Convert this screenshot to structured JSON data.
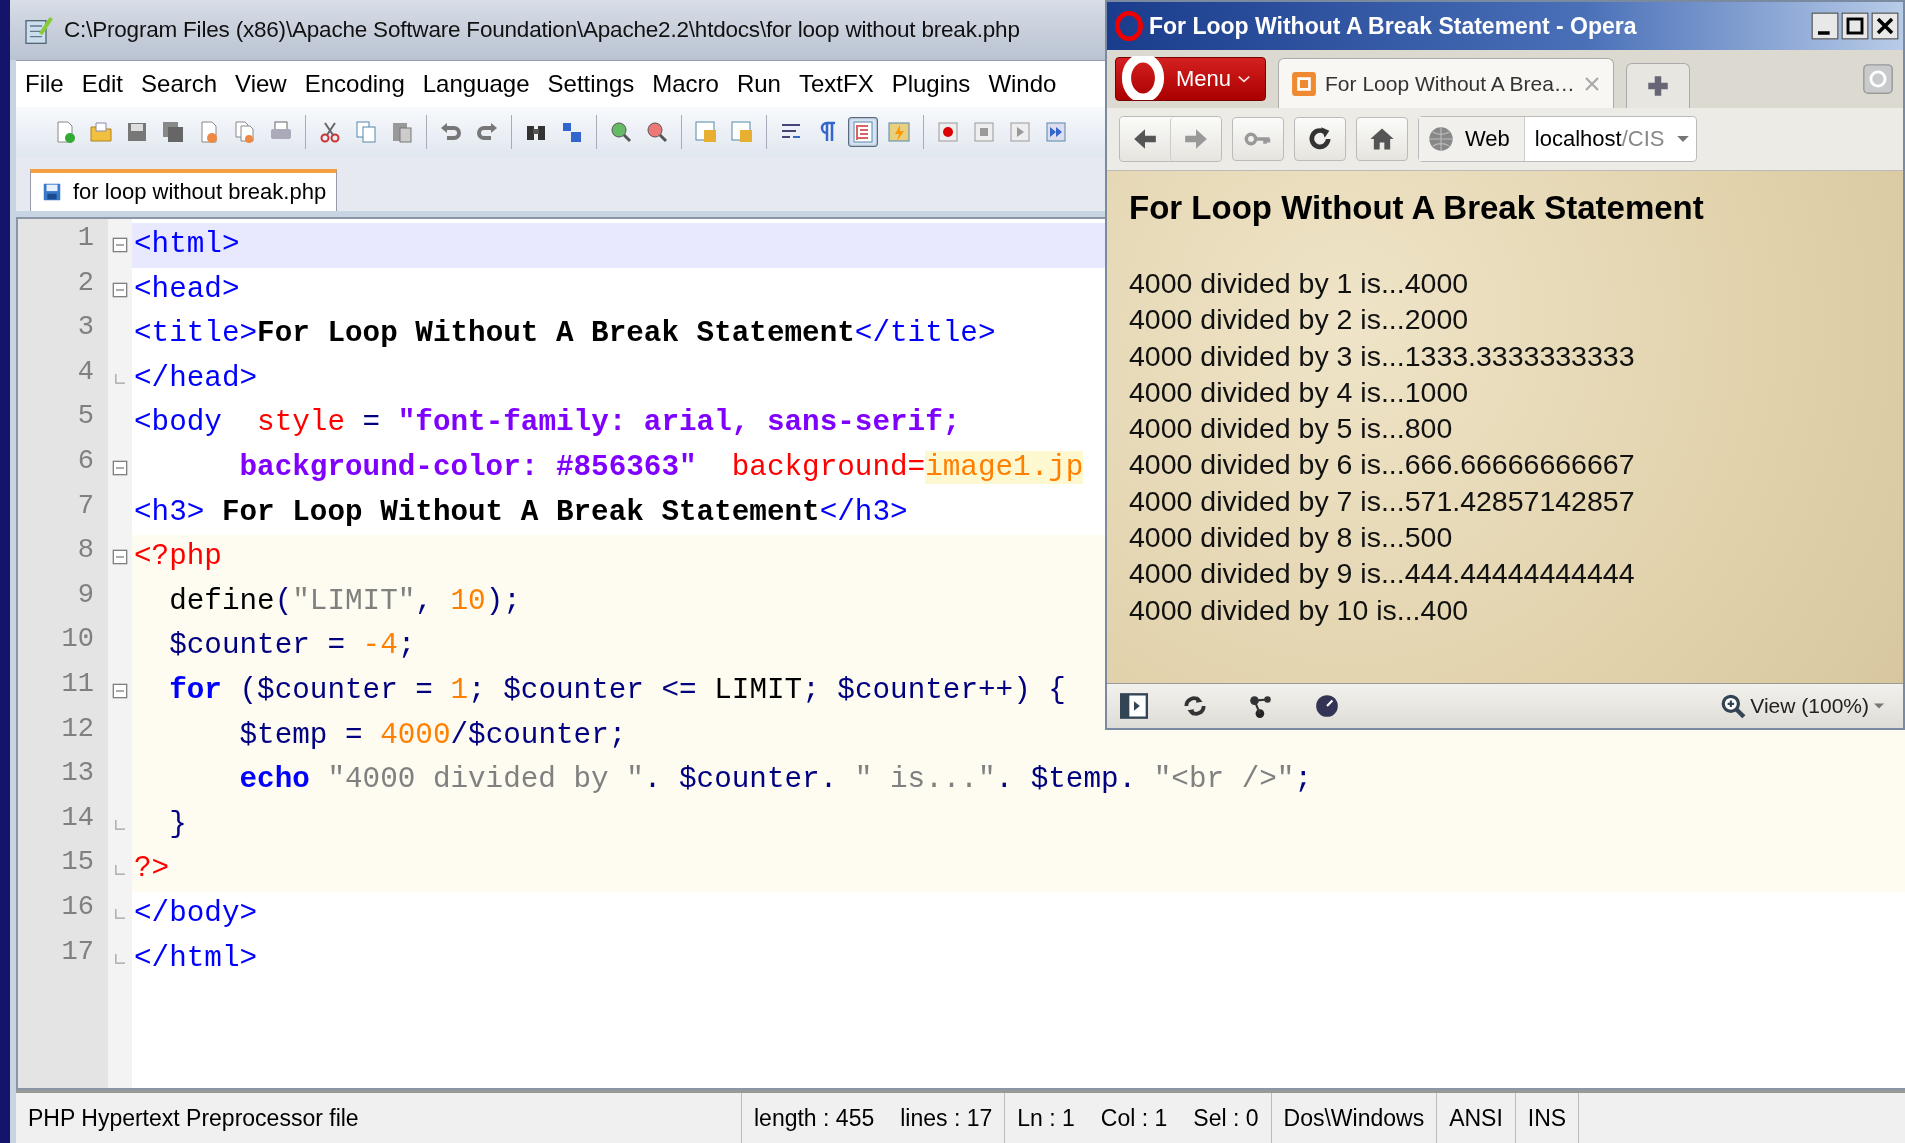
{
  "editor": {
    "title": "C:\\Program Files (x86)\\Apache Software Foundation\\Apache2.2\\htdocs\\for loop without break.php",
    "menu": [
      {
        "label": "File"
      },
      {
        "label": "Edit"
      },
      {
        "label": "Search"
      },
      {
        "label": "View"
      },
      {
        "label": "Encoding"
      },
      {
        "label": "Language"
      },
      {
        "label": "Settings"
      },
      {
        "label": "Macro"
      },
      {
        "label": "Run"
      },
      {
        "label": "TextFX"
      },
      {
        "label": "Plugins"
      },
      {
        "label": "Windo"
      }
    ],
    "toolbar": [
      {
        "pressed": false
      },
      {
        "pressed": false
      },
      {
        "pressed": false
      },
      {
        "pressed": false
      },
      {
        "pressed": false
      },
      {
        "pressed": false
      },
      {
        "pressed": false
      },
      {
        "pressed": false
      },
      {
        "pressed": false
      },
      {
        "pressed": false
      },
      {
        "pressed": false
      },
      {
        "pressed": false
      },
      {
        "pressed": false
      },
      {
        "pressed": false
      },
      {
        "pressed": false
      },
      {
        "pressed": false
      },
      {
        "pressed": false
      },
      {
        "pressed": false
      },
      {
        "pressed": false
      },
      {
        "pressed": false
      },
      {
        "pressed": true
      },
      {
        "pressed": false
      },
      {
        "pressed": false
      },
      {
        "pressed": false
      },
      {
        "pressed": false
      },
      {
        "pressed": false
      }
    ],
    "tabs": [
      {
        "label": "for loop without break.php",
        "selected": true
      }
    ],
    "lines": [
      {
        "number": "1",
        "fold_start": true,
        "fold_end": false,
        "current": true,
        "embedded": false,
        "tokens": [
          {
            "kind": "tag",
            "text": "<html>"
          }
        ]
      },
      {
        "number": "2",
        "fold_start": true,
        "fold_end": false,
        "current": false,
        "embedded": false,
        "tokens": [
          {
            "kind": "tag",
            "text": "<head>"
          }
        ]
      },
      {
        "number": "3",
        "fold_start": false,
        "fold_end": false,
        "current": false,
        "embedded": false,
        "tokens": [
          {
            "kind": "tag",
            "text": "<title>"
          },
          {
            "kind": "bold",
            "text": "For Loop Without A Break Statement"
          },
          {
            "kind": "tag",
            "text": "</title>"
          }
        ]
      },
      {
        "number": "4",
        "fold_start": false,
        "fold_end": true,
        "current": false,
        "embedded": false,
        "tokens": [
          {
            "kind": "tag",
            "text": "</head>"
          }
        ]
      },
      {
        "number": "5",
        "fold_start": false,
        "fold_end": false,
        "current": false,
        "embedded": false,
        "tokens": [
          {
            "kind": "tag",
            "text": "<body  "
          },
          {
            "kind": "attr",
            "text": "style"
          },
          {
            "kind": "op",
            "text": " = "
          },
          {
            "kind": "string",
            "text": "\"font-family: arial, sans-serif;"
          }
        ]
      },
      {
        "number": "6",
        "fold_start": true,
        "fold_end": false,
        "current": false,
        "embedded": false,
        "tokens": [
          {
            "kind": "string",
            "text": "      background-color: #856363\"  "
          },
          {
            "kind": "attr",
            "text": "background="
          },
          {
            "kind": "value",
            "text": "image1.jp"
          }
        ]
      },
      {
        "number": "7",
        "fold_start": false,
        "fold_end": false,
        "current": false,
        "embedded": false,
        "tokens": [
          {
            "kind": "tag",
            "text": "<h3>"
          },
          {
            "kind": "bold",
            "text": " For Loop Without A Break Statement"
          },
          {
            "kind": "tag",
            "text": "</h3>"
          }
        ]
      },
      {
        "number": "8",
        "fold_start": true,
        "fold_end": false,
        "current": false,
        "embedded": true,
        "tokens": [
          {
            "kind": "php",
            "text": "<?php"
          }
        ]
      },
      {
        "number": "9",
        "fold_start": false,
        "fold_end": false,
        "current": false,
        "embedded": true,
        "tokens": [
          {
            "kind": "func",
            "text": "  define"
          },
          {
            "kind": "op",
            "text": "("
          },
          {
            "kind": "str",
            "text": "\"LIMIT\""
          },
          {
            "kind": "op",
            "text": ", "
          },
          {
            "kind": "num",
            "text": "10"
          },
          {
            "kind": "op",
            "text": ");"
          }
        ]
      },
      {
        "number": "10",
        "fold_start": false,
        "fold_end": false,
        "current": false,
        "embedded": true,
        "tokens": [
          {
            "kind": "var",
            "text": "  $counter"
          },
          {
            "kind": "op",
            "text": " = "
          },
          {
            "kind": "num",
            "text": "-4"
          },
          {
            "kind": "op",
            "text": ";"
          }
        ]
      },
      {
        "number": "11",
        "fold_start": true,
        "fold_end": false,
        "current": false,
        "embedded": true,
        "tokens": [
          {
            "kind": "kw",
            "text": "  for"
          },
          {
            "kind": "op",
            "text": " ("
          },
          {
            "kind": "var",
            "text": "$counter"
          },
          {
            "kind": "op",
            "text": " = "
          },
          {
            "kind": "num",
            "text": "1"
          },
          {
            "kind": "op",
            "text": "; "
          },
          {
            "kind": "var",
            "text": "$counter"
          },
          {
            "kind": "op",
            "text": " <= "
          },
          {
            "kind": "func",
            "text": "LIMIT"
          },
          {
            "kind": "op",
            "text": "; "
          },
          {
            "kind": "var",
            "text": "$counter"
          },
          {
            "kind": "op",
            "text": "++) {"
          }
        ]
      },
      {
        "number": "12",
        "fold_start": false,
        "fold_end": false,
        "current": false,
        "embedded": true,
        "tokens": [
          {
            "kind": "var",
            "text": "      $temp"
          },
          {
            "kind": "op",
            "text": " = "
          },
          {
            "kind": "num",
            "text": "4000"
          },
          {
            "kind": "op",
            "text": "/"
          },
          {
            "kind": "var",
            "text": "$counter"
          },
          {
            "kind": "op",
            "text": ";"
          }
        ]
      },
      {
        "number": "13",
        "fold_start": false,
        "fold_end": false,
        "current": false,
        "embedded": true,
        "tokens": [
          {
            "kind": "kw",
            "text": "      echo"
          },
          {
            "kind": "str",
            "text": " \"4000 divided by \""
          },
          {
            "kind": "op",
            "text": ". "
          },
          {
            "kind": "var",
            "text": "$counter"
          },
          {
            "kind": "op",
            "text": ". "
          },
          {
            "kind": "str",
            "text": "\" is...\""
          },
          {
            "kind": "op",
            "text": ". "
          },
          {
            "kind": "var",
            "text": "$temp"
          },
          {
            "kind": "op",
            "text": ". "
          },
          {
            "kind": "str",
            "text": "\"<br />\""
          },
          {
            "kind": "op",
            "text": ";"
          }
        ]
      },
      {
        "number": "14",
        "fold_start": false,
        "fold_end": true,
        "current": false,
        "embedded": true,
        "tokens": [
          {
            "kind": "op",
            "text": "  }"
          }
        ]
      },
      {
        "number": "15",
        "fold_start": false,
        "fold_end": true,
        "current": false,
        "embedded": true,
        "tokens": [
          {
            "kind": "php",
            "text": "?>"
          }
        ]
      },
      {
        "number": "16",
        "fold_start": false,
        "fold_end": true,
        "current": false,
        "embedded": false,
        "tokens": [
          {
            "kind": "tag",
            "text": "</body>"
          }
        ]
      },
      {
        "number": "17",
        "fold_start": false,
        "fold_end": true,
        "current": false,
        "embedded": false,
        "tokens": [
          {
            "kind": "tag",
            "text": "</html>"
          }
        ]
      }
    ],
    "status_bar": [
      {
        "items": [
          "PHP Hypertext Preprocessor file"
        ]
      },
      {
        "items": [
          "length : 455",
          "lines : 17"
        ]
      },
      {
        "items": [
          "Ln : 1",
          "Col : 1",
          "Sel : 0"
        ]
      },
      {
        "items": [
          "Dos\\Windows"
        ]
      },
      {
        "items": [
          "ANSI"
        ]
      },
      {
        "items": [
          "INS"
        ]
      }
    ]
  },
  "browser": {
    "title": "For Loop Without A Break Statement - Opera",
    "menu_button": "Menu",
    "tabs": [
      {
        "label": "For Loop Without A Brea…",
        "selected": true
      }
    ],
    "search_engine": "Web",
    "address": {
      "host": "localhost",
      "path": "/CIS"
    },
    "page": {
      "heading": "For Loop Without A Break Statement",
      "lines": [
        "4000 divided by 1 is...4000",
        "4000 divided by 2 is...2000",
        "4000 divided by 3 is...1333.3333333333",
        "4000 divided by 4 is...1000",
        "4000 divided by 5 is...800",
        "4000 divided by 6 is...666.66666666667",
        "4000 divided by 7 is...571.42857142857",
        "4000 divided by 8 is...500",
        "4000 divided by 9 is...444.44444444444",
        "4000 divided by 10 is...400"
      ]
    },
    "zoom": "View (100%)"
  }
}
